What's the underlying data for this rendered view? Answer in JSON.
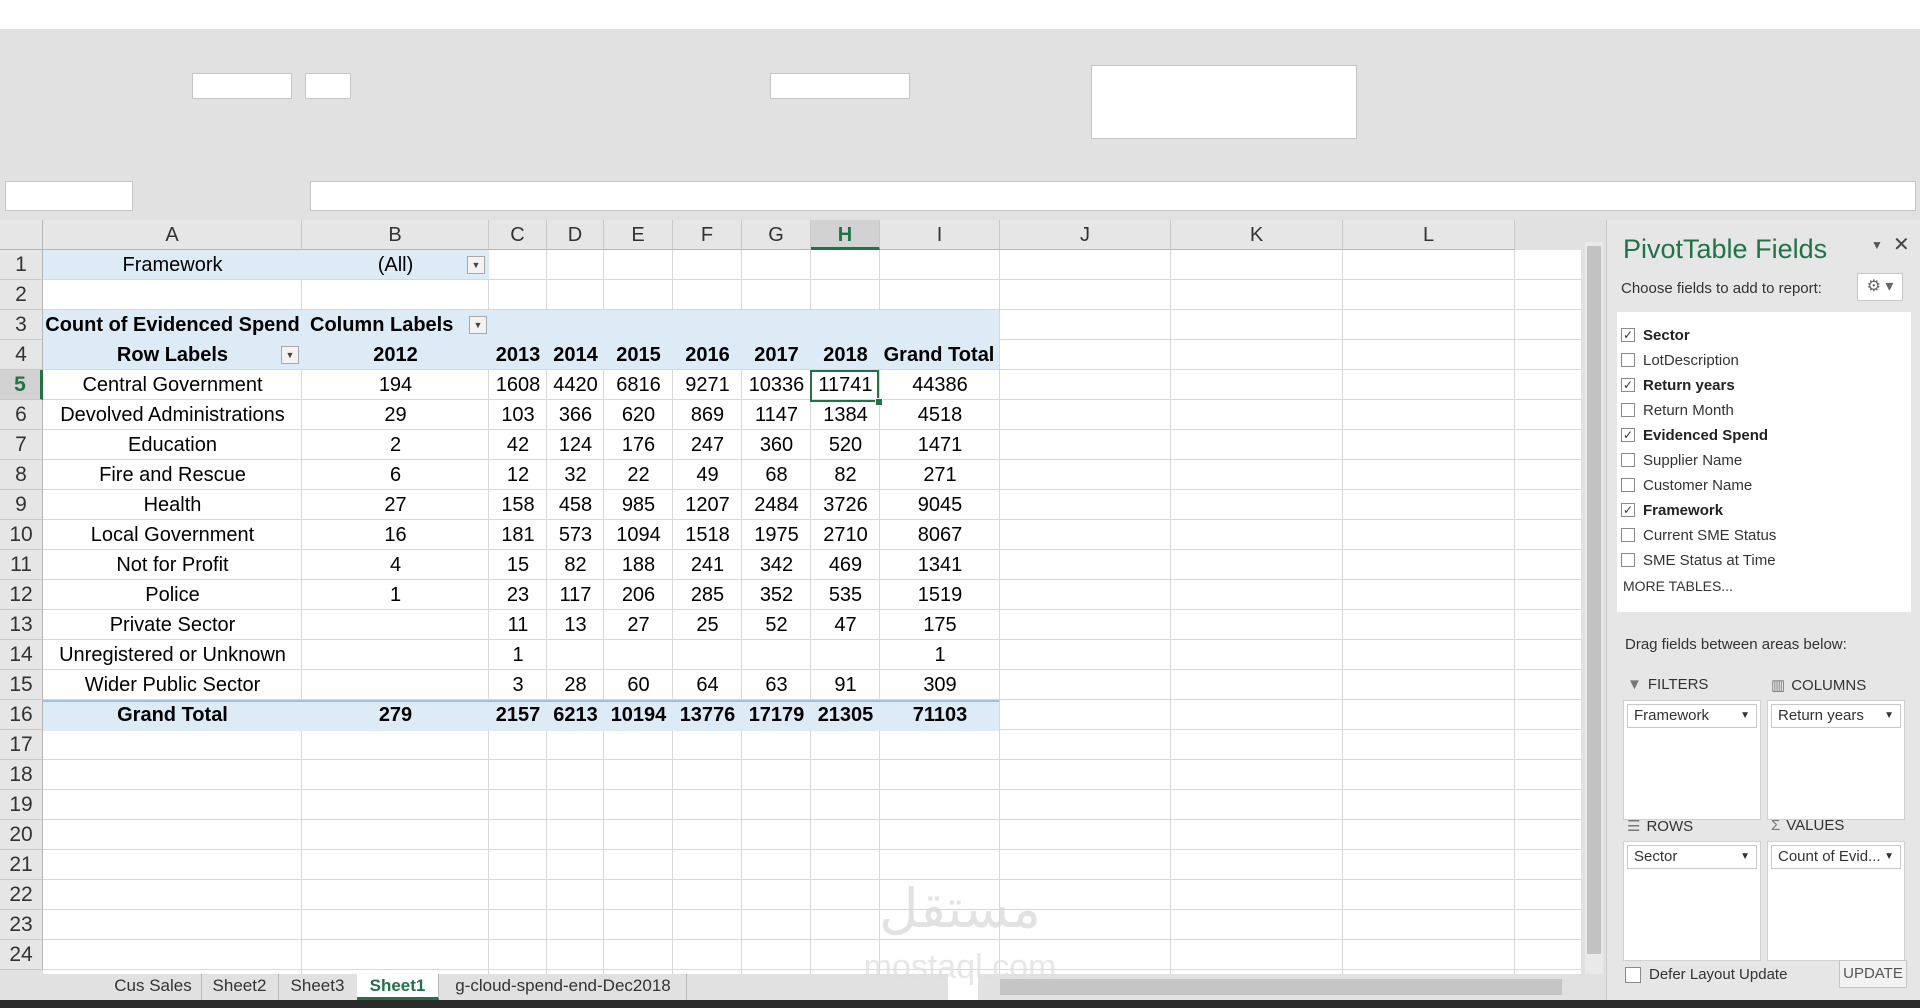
{
  "columns": [
    "A",
    "B",
    "C",
    "D",
    "E",
    "F",
    "G",
    "H",
    "I",
    "J",
    "K",
    "L"
  ],
  "selected_column": "H",
  "rows": [
    "1",
    "2",
    "3",
    "4",
    "5",
    "6",
    "7",
    "8",
    "9",
    "10",
    "11",
    "12",
    "13",
    "14",
    "15",
    "16",
    "17",
    "18",
    "19",
    "20",
    "21",
    "22",
    "23",
    "24"
  ],
  "selected_row": "5",
  "pivot": {
    "filter_label": "Framework",
    "filter_value": "(All)",
    "value_label": "Count of Evidenced Spend",
    "column_labels": "Column Labels",
    "row_labels": "Row Labels",
    "years": [
      "2012",
      "2013",
      "2014",
      "2015",
      "2016",
      "2017",
      "2018"
    ],
    "grand_total_label": "Grand Total",
    "data_rows": [
      {
        "label": "Central Government",
        "values": [
          "194",
          "1608",
          "4420",
          "6816",
          "9271",
          "10336",
          "11741"
        ],
        "total": "44386"
      },
      {
        "label": "Devolved Administrations",
        "values": [
          "29",
          "103",
          "366",
          "620",
          "869",
          "1147",
          "1384"
        ],
        "total": "4518"
      },
      {
        "label": "Education",
        "values": [
          "2",
          "42",
          "124",
          "176",
          "247",
          "360",
          "520"
        ],
        "total": "1471"
      },
      {
        "label": "Fire and Rescue",
        "values": [
          "6",
          "12",
          "32",
          "22",
          "49",
          "68",
          "82"
        ],
        "total": "271"
      },
      {
        "label": "Health",
        "values": [
          "27",
          "158",
          "458",
          "985",
          "1207",
          "2484",
          "3726"
        ],
        "total": "9045"
      },
      {
        "label": "Local Government",
        "values": [
          "16",
          "181",
          "573",
          "1094",
          "1518",
          "1975",
          "2710"
        ],
        "total": "8067"
      },
      {
        "label": "Not for Profit",
        "values": [
          "4",
          "15",
          "82",
          "188",
          "241",
          "342",
          "469"
        ],
        "total": "1341"
      },
      {
        "label": "Police",
        "values": [
          "1",
          "23",
          "117",
          "206",
          "285",
          "352",
          "535"
        ],
        "total": "1519"
      },
      {
        "label": "Private Sector",
        "values": [
          "",
          "11",
          "13",
          "27",
          "25",
          "52",
          "47"
        ],
        "total": "175"
      },
      {
        "label": "Unregistered or Unknown",
        "values": [
          "",
          "1",
          "",
          "",
          "",
          "",
          ""
        ],
        "total": "1"
      },
      {
        "label": "Wider Public Sector",
        "values": [
          "",
          "3",
          "28",
          "60",
          "64",
          "63",
          "91"
        ],
        "total": "309"
      }
    ],
    "grand_total": {
      "values": [
        "279",
        "2157",
        "6213",
        "10194",
        "13776",
        "17179",
        "21305"
      ],
      "total": "71103"
    }
  },
  "sheet_tabs": [
    "Cus Sales",
    "Sheet2",
    "Sheet3",
    "Sheet1",
    "g-cloud-spend-end-Dec2018"
  ],
  "active_tab": "Sheet1",
  "field_pane": {
    "title": "PivotTable Fields",
    "subtitle": "Choose fields to add to report:",
    "fields": [
      {
        "name": "Sector",
        "checked": true
      },
      {
        "name": "LotDescription",
        "checked": false
      },
      {
        "name": "Return years",
        "checked": true
      },
      {
        "name": "Return Month",
        "checked": false
      },
      {
        "name": "Evidenced Spend",
        "checked": true
      },
      {
        "name": "Supplier Name",
        "checked": false
      },
      {
        "name": "Customer Name",
        "checked": false
      },
      {
        "name": "Framework",
        "checked": true
      },
      {
        "name": "Current SME Status",
        "checked": false
      },
      {
        "name": "SME Status at Time",
        "checked": false
      }
    ],
    "more_tables": "MORE TABLES...",
    "drag_text": "Drag fields between areas below:",
    "filters_label": "FILTERS",
    "columns_label": "COLUMNS",
    "rows_label": "ROWS",
    "values_label": "VALUES",
    "filters_field": "Framework",
    "columns_field": "Return years",
    "rows_field": "Sector",
    "values_field": "Count of Evid...",
    "defer_label": "Defer Layout Update",
    "update_label": "UPDATE"
  },
  "watermark": {
    "arabic": "مستقل",
    "latin": "mostaql.com"
  },
  "colors": {
    "accent": "#217346",
    "band": "#ddebf7",
    "pane_title": "#217346"
  }
}
